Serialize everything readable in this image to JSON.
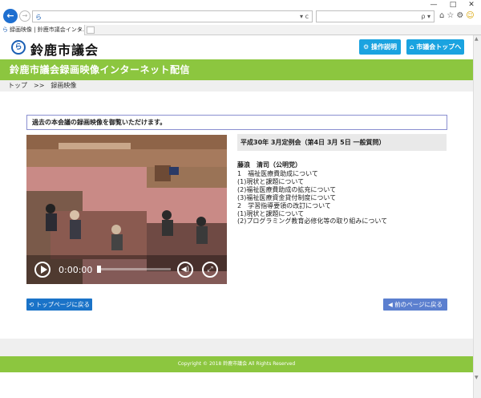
{
  "browser": {
    "tab_title": "録画映像 | 鈴鹿市議会インタ...",
    "tab_close": "×",
    "address_controls": "▾ c",
    "search_controls": "ρ ▾",
    "win_min": "—",
    "win_max": "□",
    "win_close": "✕",
    "back_glyph": "←",
    "forward_glyph": "→",
    "tools": "⌂☆⚙"
  },
  "header": {
    "logo_glyph": "ら",
    "site_name": "鈴鹿市議会",
    "help_button": "⚙ 操作説明",
    "top_button": "⌂ 市議会トップへ"
  },
  "banner": {
    "title": "鈴鹿市議会録画映像インターネット配信"
  },
  "breadcrumb": {
    "home": "トップ",
    "sep": ">>",
    "current": "録画映像"
  },
  "notice": {
    "text": "過去の本会議の録画映像を御覧いただけます。"
  },
  "player": {
    "time": "0:00:00",
    "progress": 0,
    "volume_glyph": "◀)",
    "fullscreen_glyph": "⤢"
  },
  "meeting": {
    "title": "平成30年 3月定例会（第4日 3月 5日 一般質問）",
    "speaker": "藤浪　清司（公明党）",
    "agenda": [
      "1　福祉医療費助成について",
      "(1)現状と課題について",
      "(2)福祉医療費助成の拡充について",
      "(3)福祉医療資金貸付制度について",
      "2　学習指導要領の改訂について",
      "(1)現状と課題について",
      "(2)プログラミング教育必修化等の取り組みについて"
    ]
  },
  "actions": {
    "back_to_top": "⟲ トップページに戻る",
    "prev_page": "◀ 前のページに戻る"
  },
  "footer": {
    "copyright": "Copyright © 2018 鈴鹿市議会 All Rights Reserved"
  },
  "colors": {
    "green": "#8cc63f",
    "button_blue": "#1aa3e0",
    "link_blue": "#1a73c8"
  }
}
